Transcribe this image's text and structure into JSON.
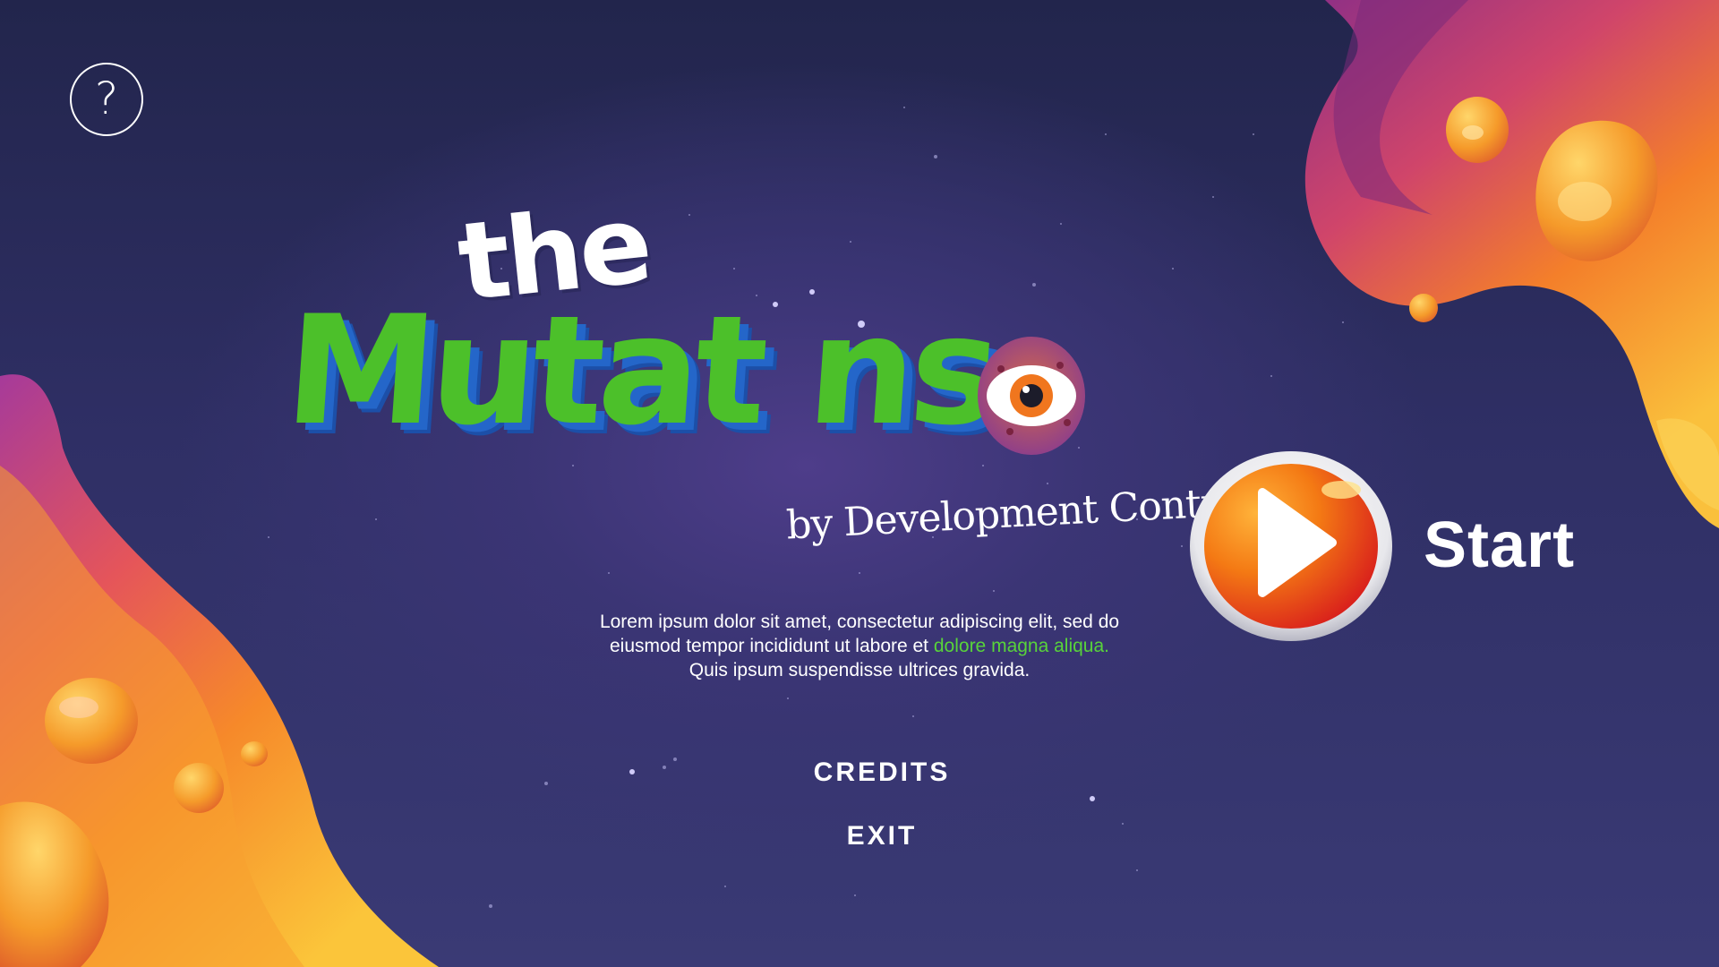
{
  "game": {
    "title_small": "the",
    "title_main": "Mutat  ns",
    "byline": "by Development Control"
  },
  "description": {
    "line1": "Lorem ipsum dolor sit amet, consectetur adipiscing elit, sed do",
    "line2_plain": "eiusmod tempor incididunt ut labore et ",
    "line2_highlight": "dolore magna aliqua.",
    "line3": "Quis ipsum suspendisse ultrices gravida."
  },
  "buttons": {
    "help_glyph": "?",
    "start_label": "Start",
    "credits_label": "CREDITS",
    "exit_label": "EXIT"
  },
  "icons": {
    "help": "question-circle-icon",
    "play": "play-icon"
  },
  "colors": {
    "background": "#2a2a58",
    "title_green": "#4cc02a",
    "title_shadow_blue": "#2466c9",
    "highlight_green": "#58d33a",
    "play_red": "#e5241e",
    "play_orange": "#f47a14",
    "blob_orange": "#f5871f",
    "blob_magenta": "#b03a8c"
  }
}
